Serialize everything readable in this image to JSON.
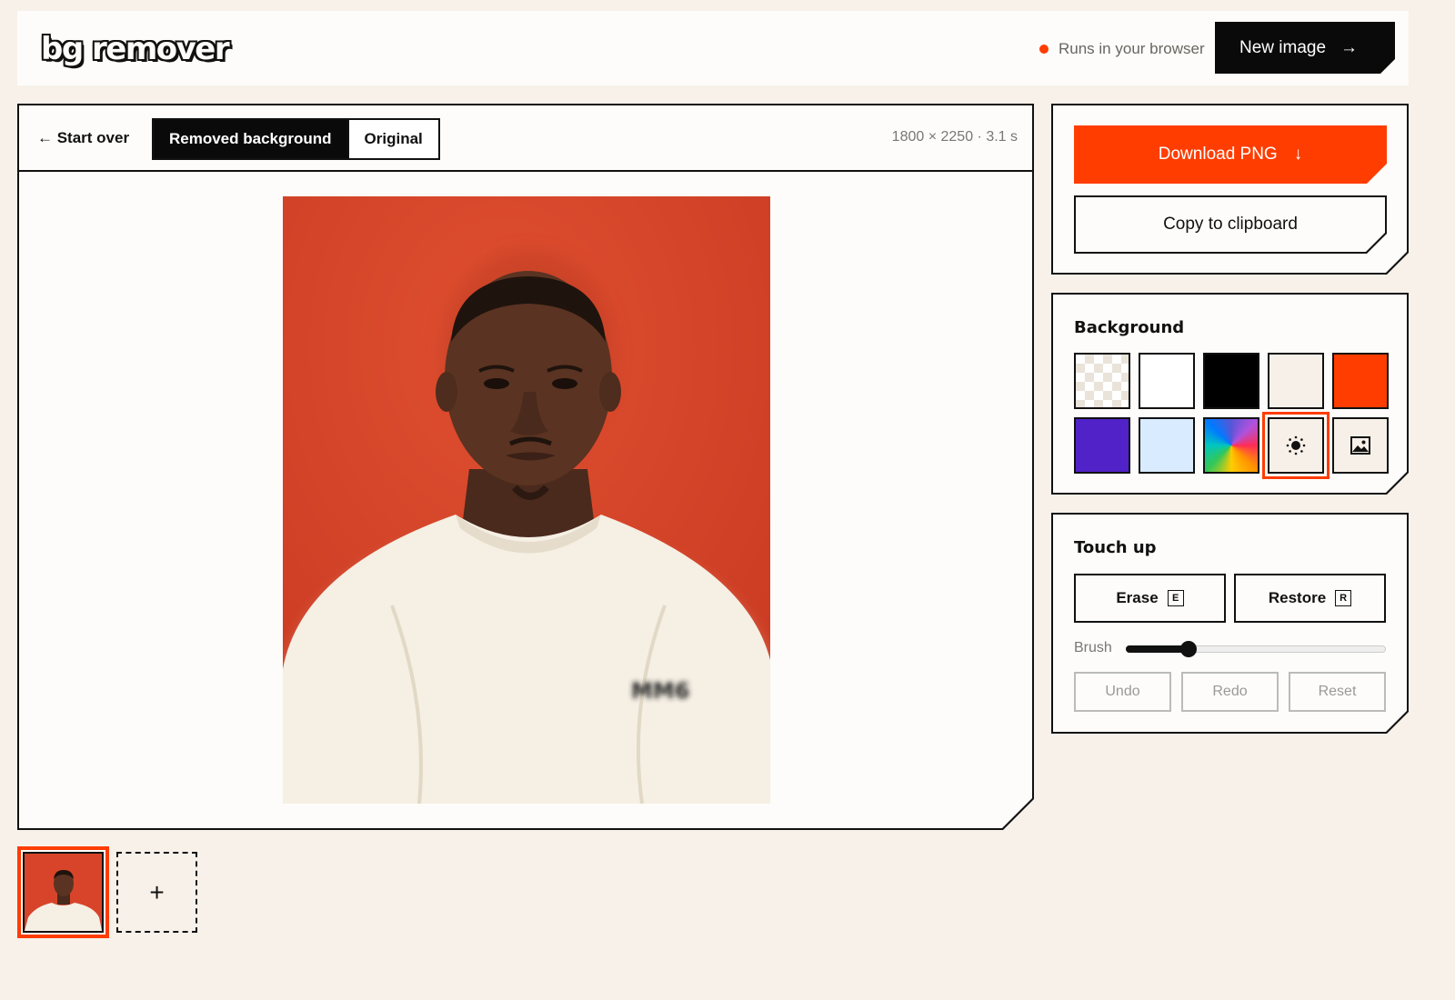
{
  "header": {
    "logo": "bg remover",
    "status": "Runs in your browser",
    "new_image_label": "New image",
    "new_image_arrow": "→"
  },
  "viewer": {
    "start_over_label": "← Start over",
    "tabs": [
      {
        "label": "Removed background",
        "active": true
      },
      {
        "label": "Original",
        "active": false
      }
    ],
    "meta": "1800 × 2250 · 3.1 s"
  },
  "thumbnails": {
    "add_label": "+"
  },
  "export": {
    "download_label": "Download PNG",
    "download_icon": "↓",
    "copy_label": "Copy to clipboard"
  },
  "background": {
    "title": "Background",
    "swatches": [
      {
        "name": "transparent",
        "color": "checker"
      },
      {
        "name": "white",
        "color": "#ffffff"
      },
      {
        "name": "black",
        "color": "#000000"
      },
      {
        "name": "cream",
        "color": "#f6f0e8"
      },
      {
        "name": "orange",
        "color": "#ff3d00"
      },
      {
        "name": "purple",
        "color": "#5022c8"
      },
      {
        "name": "light-blue",
        "color": "#d9ebff"
      },
      {
        "name": "rainbow",
        "color": "conic"
      },
      {
        "name": "blur",
        "icon": "sun-icon",
        "selected": true
      },
      {
        "name": "image",
        "icon": "image-icon"
      }
    ]
  },
  "touch_up": {
    "title": "Touch up",
    "erase_label": "Erase",
    "erase_key": "E",
    "restore_label": "Restore",
    "restore_key": "R",
    "brush_label": "Brush",
    "brush_value": 0.24,
    "undo_label": "Undo",
    "redo_label": "Redo",
    "reset_label": "Reset"
  },
  "colors": {
    "accent": "#ff3d00",
    "ink": "#111111",
    "page_bg": "#f7f1ea"
  }
}
